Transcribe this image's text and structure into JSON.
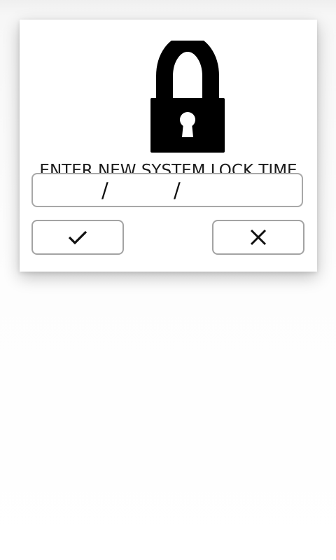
{
  "dialog": {
    "title": "ENTER NEW SYSTEM LOCK TIME",
    "lock_icon": "padlock-icon",
    "date_field": {
      "separators": [
        "/",
        "/"
      ]
    },
    "buttons": {
      "confirm_icon": "checkmark-icon",
      "cancel_icon": "close-icon"
    }
  },
  "colors": {
    "background": "#ffffff",
    "border": "#a8a8a8",
    "text": "#1b1b1b",
    "icon": "#000000"
  }
}
